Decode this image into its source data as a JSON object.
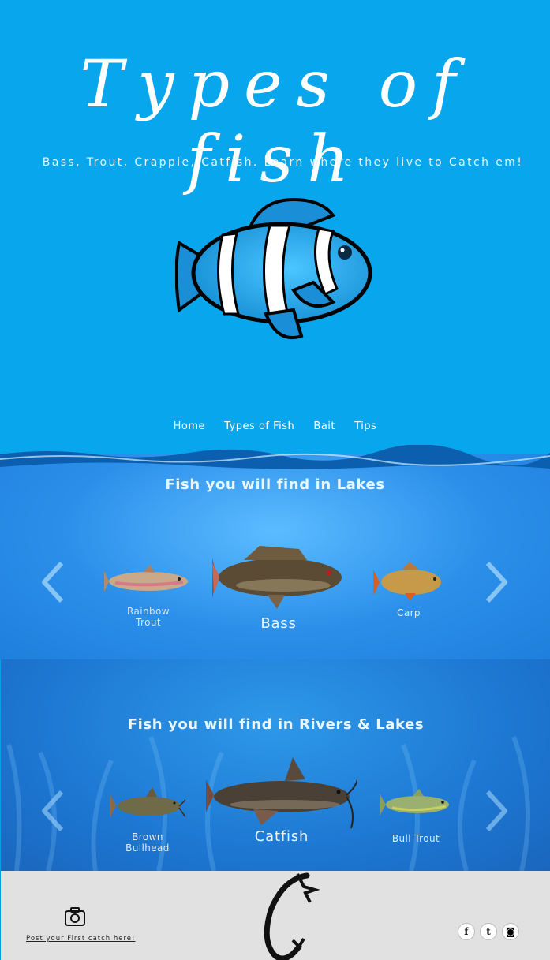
{
  "hero": {
    "title": "Types of fish",
    "subtitle": "Bass, Trout, Crappie, Catfish. Learn where they live to Catch em!",
    "image_icon": "clownfish-image"
  },
  "nav": {
    "items": [
      "Home",
      "Types of Fish",
      "Bait",
      "Tips"
    ]
  },
  "lakes": {
    "title": "Fish you will find in Lakes",
    "fish": [
      {
        "label": "Rainbow Trout",
        "icon": "rainbow-trout-image"
      },
      {
        "label": "Bass",
        "icon": "bass-image"
      },
      {
        "label": "Carp",
        "icon": "carp-image"
      }
    ],
    "prev_icon": "chevron-left-icon",
    "next_icon": "chevron-right-icon"
  },
  "rivers": {
    "title": "Fish you will find in Rivers & Lakes",
    "fish": [
      {
        "label": "Brown Bullhead",
        "icon": "brown-bullhead-image"
      },
      {
        "label": "Catfish",
        "icon": "catfish-image"
      },
      {
        "label": "Bull Trout",
        "icon": "bull-trout-image"
      }
    ],
    "prev_icon": "chevron-left-icon",
    "next_icon": "chevron-right-icon"
  },
  "footer": {
    "post_link": "Post your First catch here!",
    "camera_icon": "camera-icon",
    "logo_icon": "hook-logo-icon",
    "social": [
      {
        "name": "facebook-icon",
        "glyph": "f"
      },
      {
        "name": "twitter-icon",
        "glyph": "t"
      },
      {
        "name": "instagram-icon",
        "glyph": "◙"
      }
    ]
  },
  "colors": {
    "hero_bg": "#08a6ec",
    "lakes_bg": "#2b8fea",
    "rivers_bg": "#1d78d3",
    "footer_bg": "#e1e1e1"
  }
}
